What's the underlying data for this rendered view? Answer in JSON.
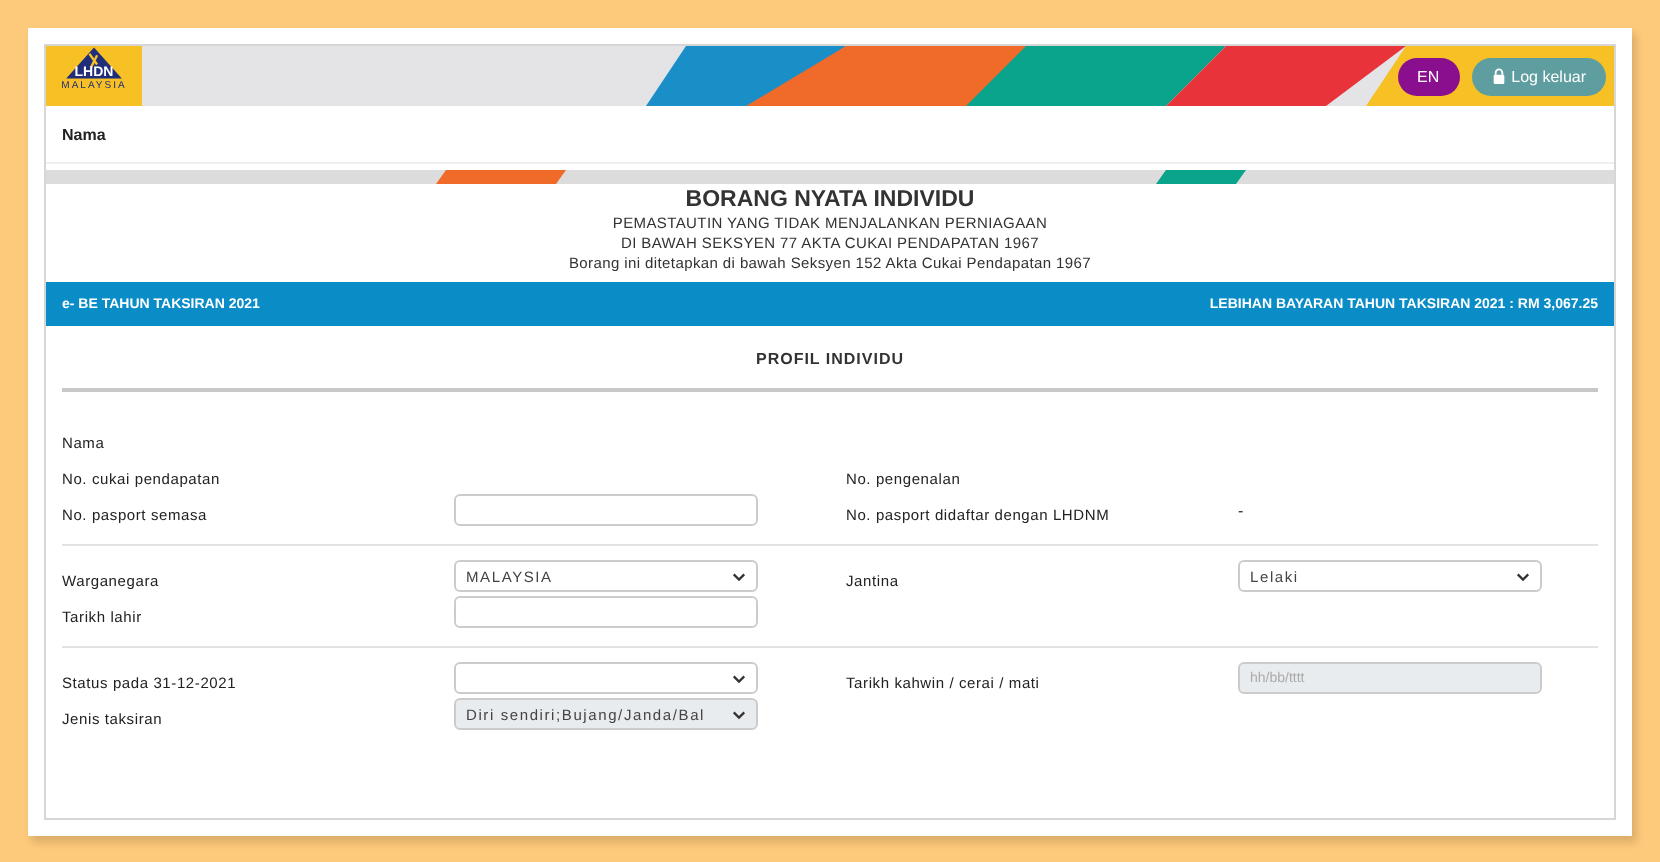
{
  "header": {
    "logo_text": "LHDN",
    "logo_subtext": "MALAYSIA",
    "language_button": "EN",
    "logout_button": "Log keluar",
    "name_label": "Nama"
  },
  "title": {
    "heading": "BORANG NYATA INDIVIDU",
    "lines": [
      "PEMASTAUTIN YANG TIDAK MENJALANKAN PERNIAGAAN",
      "DI BAWAH SEKSYEN 77 AKTA CUKAI PENDAPATAN 1967",
      "Borang ini ditetapkan di bawah Seksyen 152 Akta Cukai Pendapatan 1967"
    ]
  },
  "info_bar": {
    "left": "e- BE TAHUN TAKSIRAN 2021",
    "right": "LEBIHAN BAYARAN TAHUN TAKSIRAN 2021 : RM 3,067.25"
  },
  "section_title": "PROFIL INDIVIDU",
  "groups": [
    {
      "rows": [
        {
          "left": {
            "label": "Nama",
            "kind": "text"
          },
          "right": null
        },
        {
          "left": {
            "label": "No. cukai pendapatan",
            "kind": "text"
          },
          "right": {
            "label": "No. pengenalan",
            "kind": "text"
          }
        },
        {
          "left": {
            "label": "No. pasport semasa",
            "kind": "input",
            "disabled": false
          },
          "right": {
            "label": "No. pasport didaftar dengan LHDNM",
            "kind": "text",
            "value": "-"
          }
        }
      ]
    },
    {
      "rows": [
        {
          "left": {
            "label": "Warganegara",
            "kind": "select",
            "value": "MALAYSIA",
            "disabled": false
          },
          "right": {
            "label": "Jantina",
            "kind": "select",
            "value": "Lelaki",
            "disabled": false
          }
        },
        {
          "left": {
            "label": "Tarikh lahir",
            "kind": "input",
            "disabled": false
          },
          "right": null
        }
      ]
    },
    {
      "rows": [
        {
          "left": {
            "label": "Status pada 31-12-2021",
            "kind": "select",
            "disabled": false
          },
          "right": {
            "label": "Tarikh kahwin / cerai / mati",
            "kind": "input",
            "placeholder": "hh/bb/tttt",
            "disabled": true
          }
        },
        {
          "left": {
            "label": "Jenis taksiran",
            "kind": "select",
            "value": "Diri sendiri;Bujang/Janda/Bal",
            "disabled": true
          },
          "right": null
        }
      ]
    }
  ]
}
